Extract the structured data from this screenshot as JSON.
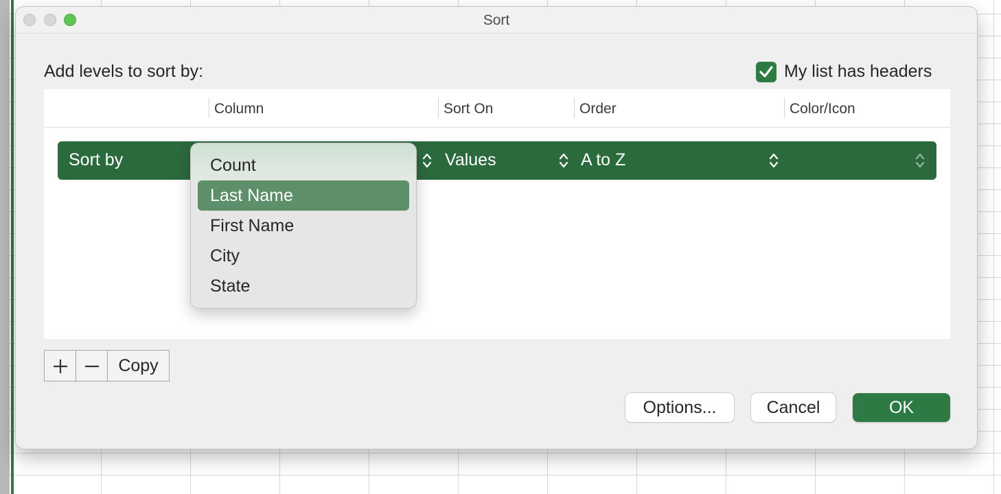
{
  "window": {
    "title": "Sort"
  },
  "dialog": {
    "add_levels_label": "Add levels to sort by:",
    "headers_checkbox": {
      "label": "My list has headers",
      "checked": true
    }
  },
  "columns": {
    "column": "Column",
    "sort_on": "Sort On",
    "order": "Order",
    "color_icon": "Color/Icon"
  },
  "sort_row": {
    "label": "Sort by",
    "sort_on": "Values",
    "order": "A to Z",
    "color_icon": ""
  },
  "dropdown": {
    "items": [
      "Count",
      "Last Name",
      "First Name",
      "City",
      "State"
    ],
    "selected": "Last Name"
  },
  "level_controls": {
    "add_icon": "plus-icon",
    "remove_icon": "minus-icon",
    "copy_label": "Copy"
  },
  "buttons": {
    "options": "Options...",
    "cancel": "Cancel",
    "ok": "OK"
  },
  "colors": {
    "accent": "#2e7a45",
    "row": "#2b6a3d",
    "selected_item": "#5e8f6b"
  }
}
